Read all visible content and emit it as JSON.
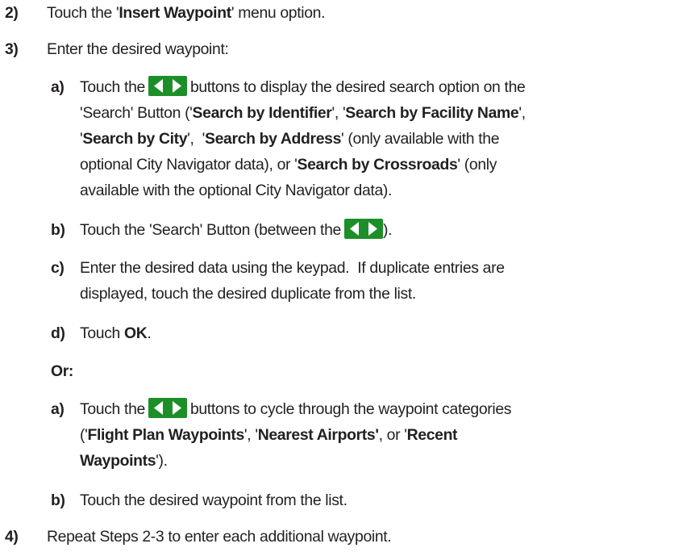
{
  "steps": {
    "s2": {
      "num": "2)",
      "t1": "Touch the '",
      "b1": "Insert Waypoint",
      "t2": "' menu option."
    },
    "s3": {
      "num": "3)",
      "text": "Enter the desired waypoint:",
      "a": {
        "num": "a)",
        "l1a": "Touch the",
        "l1b": "buttons to display the desired search option on the",
        "l2a": "'Search' Button ('",
        "l2b": "Search by Identifier",
        "l2c": "', '",
        "l2d": "Search by Facility Name",
        "l2e": "',",
        "l3a": "'",
        "l3b": "Search by City",
        "l3c": "',  '",
        "l3d": "Search by Address",
        "l3e": "' (only available with the",
        "l4a": "optional City Navigator data), or '",
        "l4b": "Search by Crossroads",
        "l4c": "' (only",
        "l5": "available with the optional City Navigator data)."
      },
      "b": {
        "num": "b)",
        "t1": "Touch the 'Search' Button (between the",
        "t2": ")."
      },
      "c": {
        "num": "c)",
        "l1": "Enter the desired data using the keypad.  If duplicate entries are",
        "l2": "displayed, touch the desired duplicate from the list."
      },
      "d": {
        "num": "d)",
        "t1": "Touch ",
        "b1": "OK",
        "t2": "."
      },
      "or": "Or:",
      "a2": {
        "num": "a)",
        "l1a": "Touch the",
        "l1b": "buttons to cycle through the waypoint categories",
        "l2a": "('",
        "l2b": "Flight Plan Waypoints",
        "l2c": "', '",
        "l2d": "Nearest Airports'",
        "l2e": ", or '",
        "l2f": "Recent",
        "l3a": "Waypoints",
        "l3b": "')."
      },
      "b2": {
        "num": "b)",
        "text": "Touch the desired waypoint from the list."
      }
    },
    "s4": {
      "num": "4)",
      "text": "Repeat Steps 2-3 to enter each additional waypoint."
    }
  },
  "icons": {
    "arrow_button": "left-right-arrows-icon",
    "arrow_bg_color": "#1c8f28",
    "arrow_fg_color": "#ffffff"
  }
}
